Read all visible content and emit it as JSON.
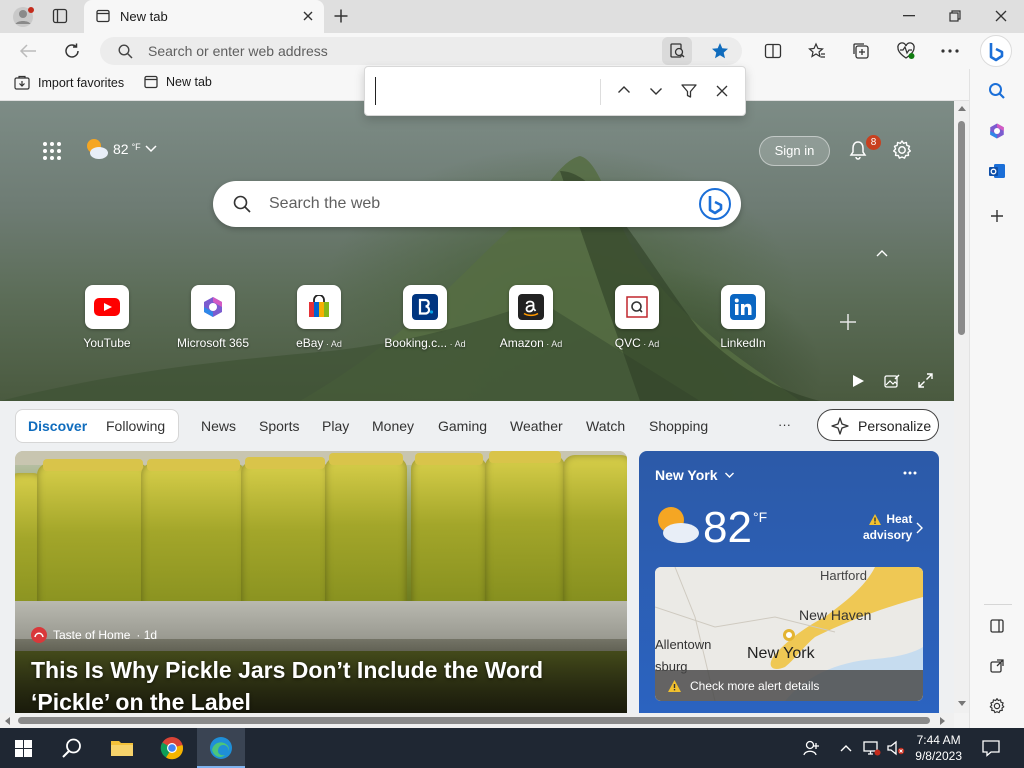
{
  "browser": {
    "tab_title": "New tab",
    "address_placeholder": "Search or enter web address"
  },
  "favorites": {
    "items": [
      "Import favorites",
      "New tab"
    ]
  },
  "find_bar": {
    "value": ""
  },
  "newtab": {
    "weather_temp": "82",
    "weather_unit": "°F",
    "search_placeholder": "Search the web",
    "sign_in": "Sign in",
    "notification_count": "8",
    "tiles": [
      {
        "label": "YouTube",
        "ad": ""
      },
      {
        "label": "Microsoft 365",
        "ad": ""
      },
      {
        "label": "eBay",
        "ad": " · Ad"
      },
      {
        "label": "Booking.c...",
        "ad": " · Ad"
      },
      {
        "label": "Amazon",
        "ad": " · Ad"
      },
      {
        "label": "QVC",
        "ad": " · Ad"
      },
      {
        "label": "LinkedIn",
        "ad": ""
      }
    ]
  },
  "feed": {
    "tabs": [
      "Discover",
      "Following"
    ],
    "nav": [
      "News",
      "Sports",
      "Play",
      "Money",
      "Gaming",
      "Weather",
      "Watch",
      "Shopping"
    ],
    "more": "···",
    "personalize": "Personalize",
    "article": {
      "source": "Taste of Home",
      "age": "· 1d",
      "title_line1": "This Is Why Pickle Jars Don’t Include the Word",
      "title_line2": "‘Pickle’ on the Label"
    },
    "weather": {
      "city": "New York",
      "temp": "82",
      "unit": "°F",
      "alert_line1": "Heat",
      "alert_line2": "advisory",
      "map_labels": [
        "Hartford",
        "New Haven",
        "Allentown",
        "New York",
        "sburg"
      ],
      "alert_details": "Check more alert details"
    }
  },
  "taskbar": {
    "time": "7:44 AM",
    "date": "9/8/2023"
  },
  "colors": {
    "accent": "#0f6cbd",
    "weather_bg": "#2b63c0",
    "taskbar": "#1f2733"
  }
}
